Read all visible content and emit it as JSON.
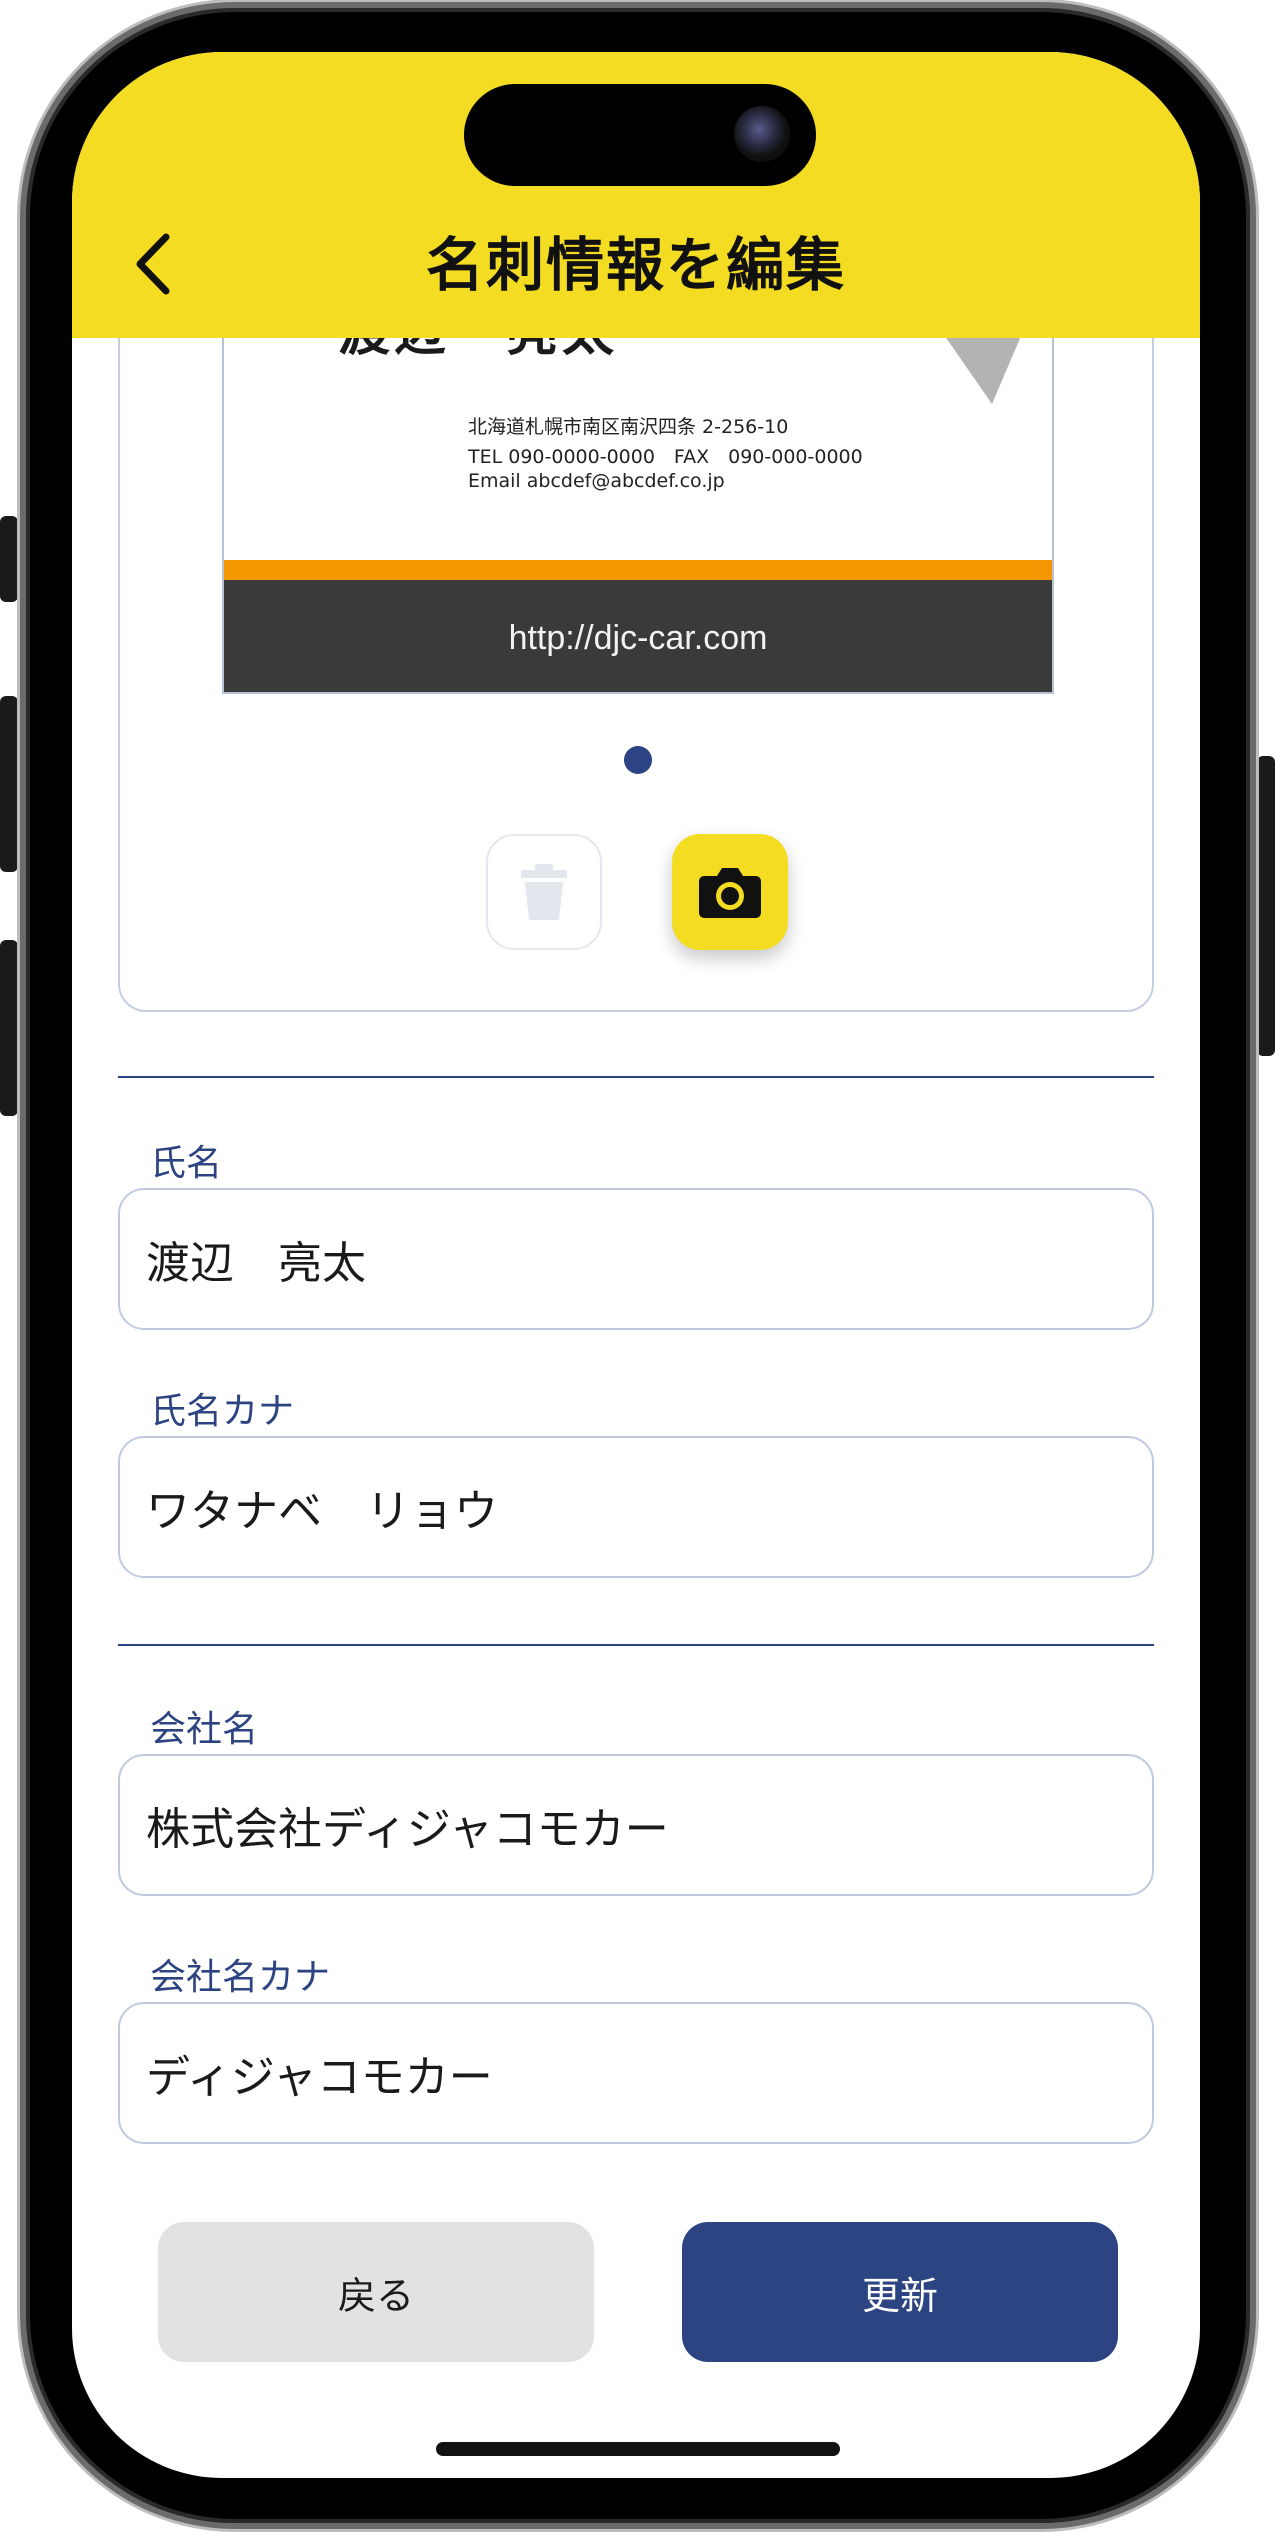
{
  "header": {
    "title": "名刺情報を編集"
  },
  "business_card": {
    "name": "渡辺　亮太",
    "address": "北海道札幌市南区南沢四条 2-256-10",
    "tel_fax": "TEL 090-0000-0000　FAX　090-000-0000",
    "email": "Email abcdef@abcdef.co.jp",
    "url": "http://djc-car.com"
  },
  "form": {
    "name_label": "氏名",
    "name_value": "渡辺　亮太",
    "name_kana_label": "氏名カナ",
    "name_kana_value": "ワタナベ　リョウ",
    "company_label": "会社名",
    "company_value": "株式会社ディジャコモカー",
    "company_kana_label": "会社名カナ",
    "company_kana_value": "ディジャコモカー"
  },
  "actions": {
    "back_label": "戻る",
    "update_label": "更新"
  },
  "colors": {
    "header": "#f3dc22",
    "accent": "#2d4482",
    "orange": "#f39800"
  },
  "icons": [
    "back-chevron-icon",
    "trash-icon",
    "camera-icon"
  ]
}
